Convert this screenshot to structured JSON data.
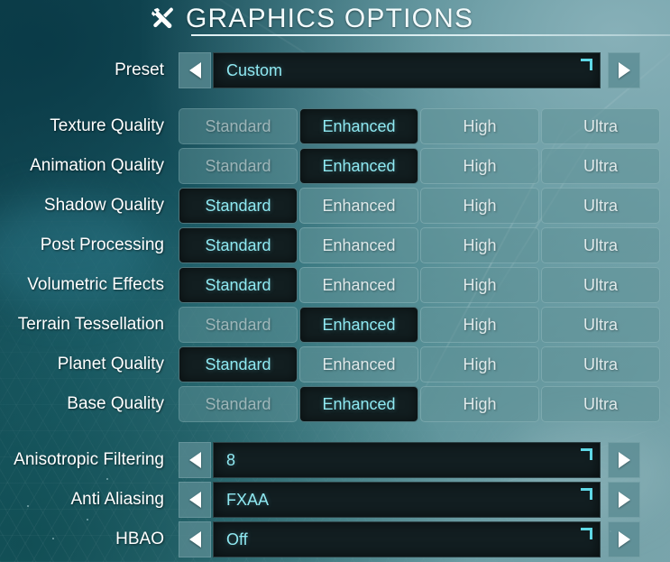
{
  "header": {
    "title": "GRAPHICS OPTIONS",
    "icon": "tools-wrench-screwdriver-icon"
  },
  "colors": {
    "accent_cyan": "#8fe9f2",
    "corner_bracket": "#5fd8e6",
    "selected_bg": "#121e20",
    "unselected_bg": "#609298",
    "label_text": "#ffffff",
    "bg_dark_teal": "#11454f",
    "bg_light_teal": "#7ba7ae"
  },
  "preset_row": {
    "label": "Preset",
    "value": "Custom",
    "prev_label": "◀",
    "next_label": "▶"
  },
  "quality_options": [
    "Standard",
    "Enhanced",
    "High",
    "Ultra"
  ],
  "quality_rows": [
    {
      "label": "Texture Quality",
      "selected": 1
    },
    {
      "label": "Animation Quality",
      "selected": 1
    },
    {
      "label": "Shadow Quality",
      "selected": 0
    },
    {
      "label": "Post Processing",
      "selected": 0
    },
    {
      "label": "Volumetric Effects",
      "selected": 0
    },
    {
      "label": "Terrain Tessellation",
      "selected": 1
    },
    {
      "label": "Planet Quality",
      "selected": 0
    },
    {
      "label": "Base Quality",
      "selected": 1
    }
  ],
  "select_rows": [
    {
      "label": "Anisotropic Filtering",
      "value": "8"
    },
    {
      "label": "Anti Aliasing",
      "value": "FXAA"
    },
    {
      "label": "HBAO",
      "value": "Off"
    }
  ]
}
